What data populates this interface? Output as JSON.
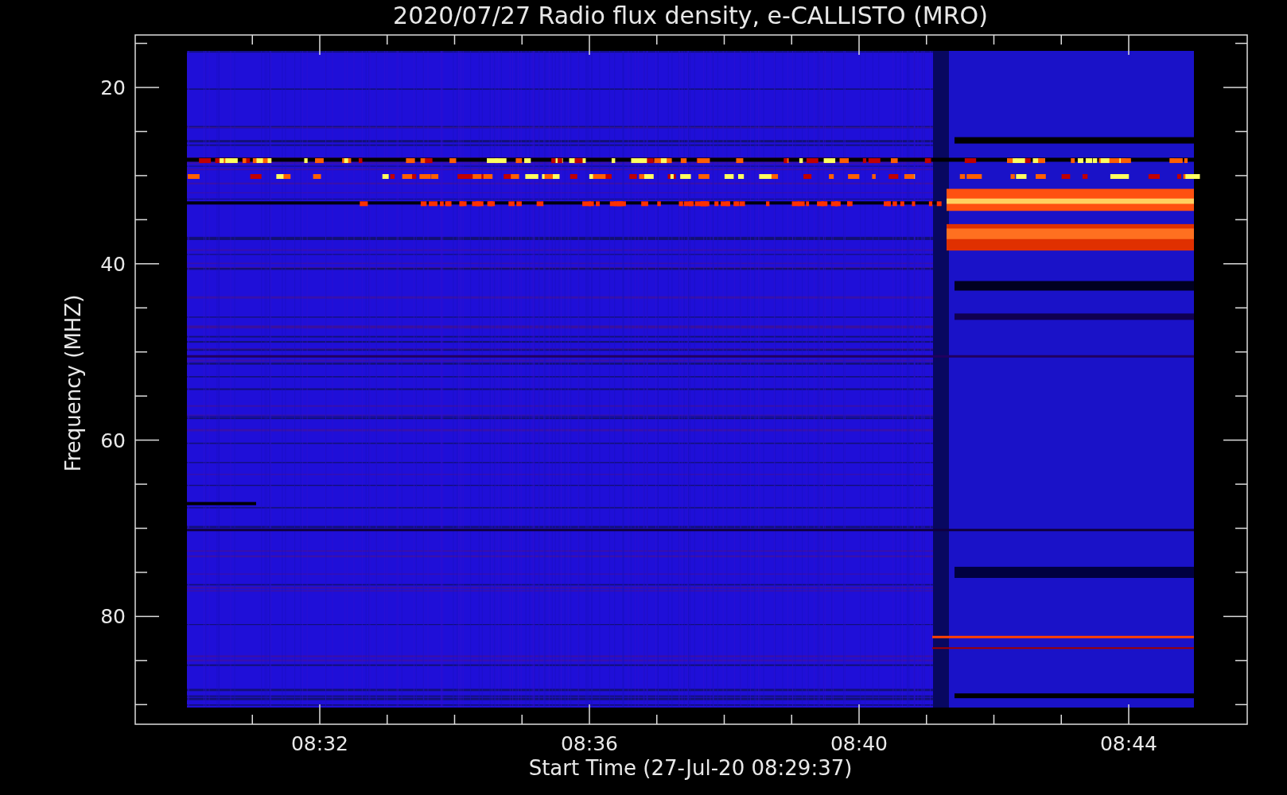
{
  "title": "2020/07/27  Radio flux density, e-CALLISTO (MRO)",
  "y_axis": {
    "label": "Frequency (MHZ)",
    "ticks": [
      "20",
      "40",
      "60",
      "80"
    ]
  },
  "x_axis": {
    "label": "Start Time (27-Jul-20 08:29:37)",
    "ticks": [
      "08:32",
      "08:36",
      "08:40",
      "08:44"
    ]
  }
}
